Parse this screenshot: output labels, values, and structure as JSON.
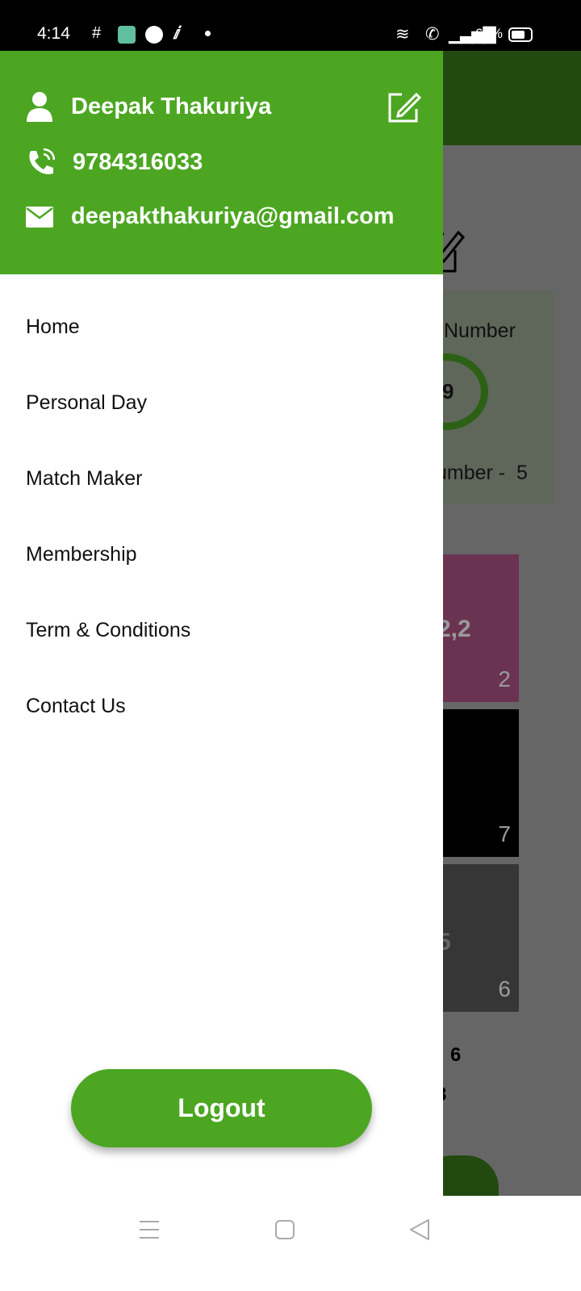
{
  "status": {
    "time": "4:14",
    "battery": "64%"
  },
  "background": {
    "card_title": "Number",
    "circle_value": "9",
    "card_footer": "umber -  5",
    "tile1_main": "2,2",
    "tile1_num": "2",
    "tile2_num": "7",
    "tile3_main": "5",
    "tile3_num": "6",
    "line1": "6",
    "line2": "8"
  },
  "profile": {
    "name": "Deepak Thakuriya",
    "phone": "9784316033",
    "email": "deepakthakuriya@gmail.com"
  },
  "menu": [
    {
      "label": "Home"
    },
    {
      "label": "Personal Day"
    },
    {
      "label": "Match Maker"
    },
    {
      "label": "Membership"
    },
    {
      "label": "Term & Conditions"
    },
    {
      "label": "Contact Us"
    }
  ],
  "logout_label": "Logout",
  "colors": {
    "primary": "#4ca622",
    "header_dark": "#224a10"
  }
}
